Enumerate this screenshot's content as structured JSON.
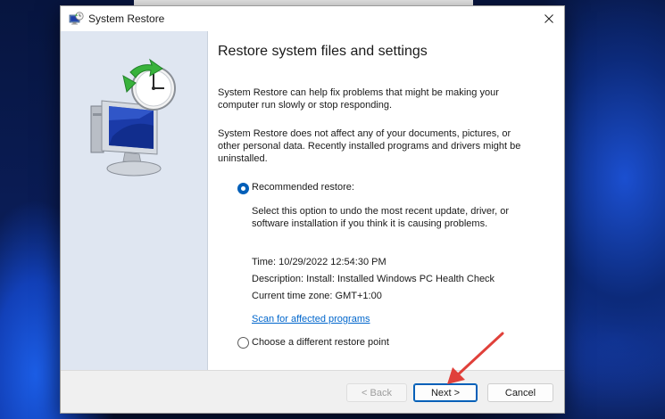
{
  "dialog": {
    "title": "System Restore",
    "close_icon": "close-icon",
    "heading": "Restore system files and settings",
    "intro_text": "System Restore can help fix problems that might be making your computer run slowly or stop responding.",
    "note_text": "System Restore does not affect any of your documents, pictures, or other personal data. Recently installed programs and drivers might be uninstalled.",
    "recommended": {
      "label": "Recommended restore:",
      "description": "Select this option to undo the most recent update, driver, or software installation if you think it is causing problems.",
      "time": "Time: 10/29/2022 12:54:30 PM",
      "desc_line": "Description: Install: Installed Windows PC Health Check",
      "timezone": "Current time zone: GMT+1:00",
      "scan_link": "Scan for affected programs",
      "selected": true
    },
    "different": {
      "label": "Choose a different restore point",
      "selected": false
    },
    "buttons": {
      "back": "< Back",
      "next": "Next >",
      "cancel": "Cancel"
    }
  },
  "colors": {
    "accent": "#005fb8",
    "link": "#0066cc",
    "left_pane": "#dfe6f1",
    "annotation_arrow": "#e0403a"
  }
}
